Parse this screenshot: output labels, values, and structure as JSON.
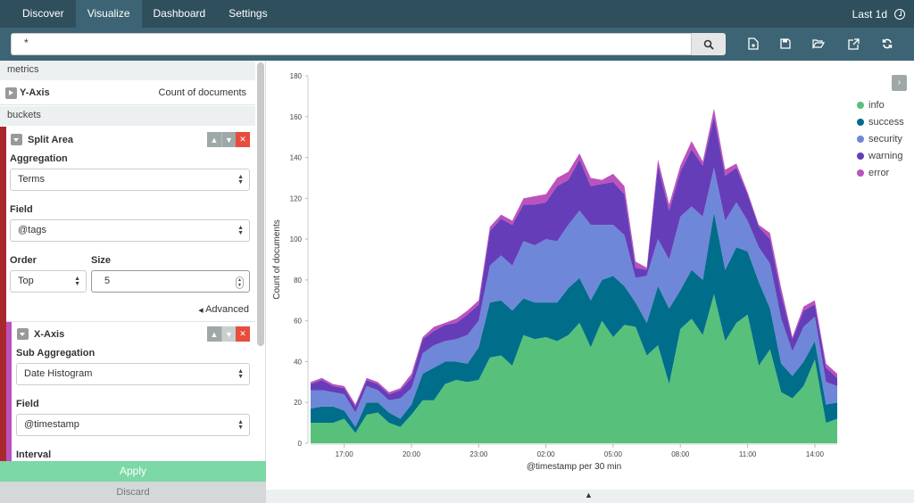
{
  "nav": {
    "tabs": [
      "Discover",
      "Visualize",
      "Dashboard",
      "Settings"
    ],
    "active": "Visualize",
    "time_range": "Last 1d"
  },
  "query": {
    "value": "*"
  },
  "sidebar": {
    "metrics_header": "metrics",
    "y_axis": {
      "label": "Y-Axis",
      "value": "Count of documents"
    },
    "buckets_header": "buckets",
    "split_area": {
      "label": "Split Area",
      "aggregation_label": "Aggregation",
      "aggregation_value": "Terms",
      "field_label": "Field",
      "field_value": "@tags",
      "order_label": "Order",
      "order_value": "Top",
      "size_label": "Size",
      "size_value": "5",
      "advanced_label": "Advanced"
    },
    "x_axis": {
      "label": "X-Axis",
      "sub_agg_label": "Sub Aggregation",
      "sub_agg_value": "Date Histogram",
      "field_label": "Field",
      "field_value": "@timestamp",
      "interval_label": "Interval"
    },
    "apply_label": "Apply",
    "discard_label": "Discard"
  },
  "colors": {
    "nav_bg": "#2f4f5d",
    "info": "#57c17b",
    "success": "#006e8a",
    "security": "#6f87d8",
    "warning": "#663db8",
    "error": "#bc52bc",
    "split_bar": "#a9282e",
    "xaxis_bar": "#bc52bc"
  },
  "chart_data": {
    "type": "area",
    "stacked": true,
    "xlabel": "@timestamp per 30 min",
    "ylabel": "Count of documents",
    "ylim": [
      0,
      180
    ],
    "yticks": [
      0,
      20,
      40,
      60,
      80,
      100,
      120,
      140,
      160,
      180
    ],
    "xtick_labels": [
      "17:00",
      "20:00",
      "23:00",
      "02:00",
      "05:00",
      "08:00",
      "11:00",
      "14:00"
    ],
    "legend_position": "top-right",
    "x": [
      "15:30",
      "16:00",
      "16:30",
      "17:00",
      "17:30",
      "18:00",
      "18:30",
      "19:00",
      "19:30",
      "20:00",
      "20:30",
      "21:00",
      "21:30",
      "22:00",
      "22:30",
      "23:00",
      "23:30",
      "00:00",
      "00:30",
      "01:00",
      "01:30",
      "02:00",
      "02:30",
      "03:00",
      "03:30",
      "04:00",
      "04:30",
      "05:00",
      "05:30",
      "06:00",
      "06:30",
      "07:00",
      "07:30",
      "08:00",
      "08:30",
      "09:00",
      "09:30",
      "10:00",
      "10:30",
      "11:00",
      "11:30",
      "12:00",
      "12:30",
      "13:00",
      "13:30",
      "14:00",
      "14:30",
      "15:00"
    ],
    "series": [
      {
        "name": "info",
        "values": [
          10,
          10,
          10,
          12,
          5,
          14,
          15,
          10,
          8,
          14,
          21,
          21,
          29,
          31,
          30,
          31,
          42,
          43,
          38,
          53,
          51,
          52,
          50,
          53,
          59,
          47,
          60,
          52,
          58,
          57,
          43,
          48,
          29,
          56,
          61,
          53,
          73,
          50,
          59,
          63,
          38,
          46,
          25,
          22,
          28,
          41,
          10,
          12
        ]
      },
      {
        "name": "success",
        "values": [
          7,
          8,
          8,
          4,
          3,
          6,
          5,
          5,
          4,
          5,
          13,
          16,
          11,
          9,
          9,
          16,
          27,
          27,
          27,
          18,
          18,
          17,
          19,
          23,
          22,
          23,
          20,
          30,
          19,
          12,
          16,
          29,
          37,
          19,
          24,
          27,
          40,
          35,
          37,
          31,
          41,
          20,
          14,
          11,
          12,
          9,
          9,
          8
        ]
      },
      {
        "name": "security",
        "values": [
          9,
          8,
          7,
          8,
          7,
          8,
          6,
          6,
          10,
          8,
          10,
          11,
          10,
          11,
          14,
          13,
          18,
          22,
          22,
          28,
          28,
          31,
          30,
          31,
          33,
          37,
          27,
          25,
          25,
          12,
          23,
          23,
          24,
          36,
          31,
          31,
          22,
          24,
          22,
          15,
          17,
          22,
          22,
          12,
          17,
          12,
          11,
          8
        ]
      },
      {
        "name": "warning",
        "values": [
          3,
          5,
          3,
          3,
          3,
          3,
          3,
          3,
          4,
          5,
          7,
          7,
          8,
          8,
          10,
          8,
          17,
          18,
          20,
          18,
          20,
          18,
          27,
          22,
          25,
          19,
          20,
          21,
          20,
          5,
          3,
          36,
          24,
          22,
          28,
          25,
          25,
          22,
          17,
          13,
          10,
          12,
          12,
          6,
          8,
          6,
          7,
          4
        ]
      },
      {
        "name": "error",
        "values": [
          1,
          1,
          1,
          1,
          1,
          1,
          1,
          1,
          1,
          2,
          1,
          2,
          1,
          2,
          2,
          2,
          2,
          2,
          2,
          3,
          4,
          4,
          4,
          4,
          3,
          4,
          2,
          4,
          4,
          3,
          1,
          3,
          3,
          3,
          4,
          2,
          4,
          3,
          2,
          1,
          1,
          3,
          3,
          1,
          2,
          2,
          2,
          2
        ]
      }
    ]
  }
}
